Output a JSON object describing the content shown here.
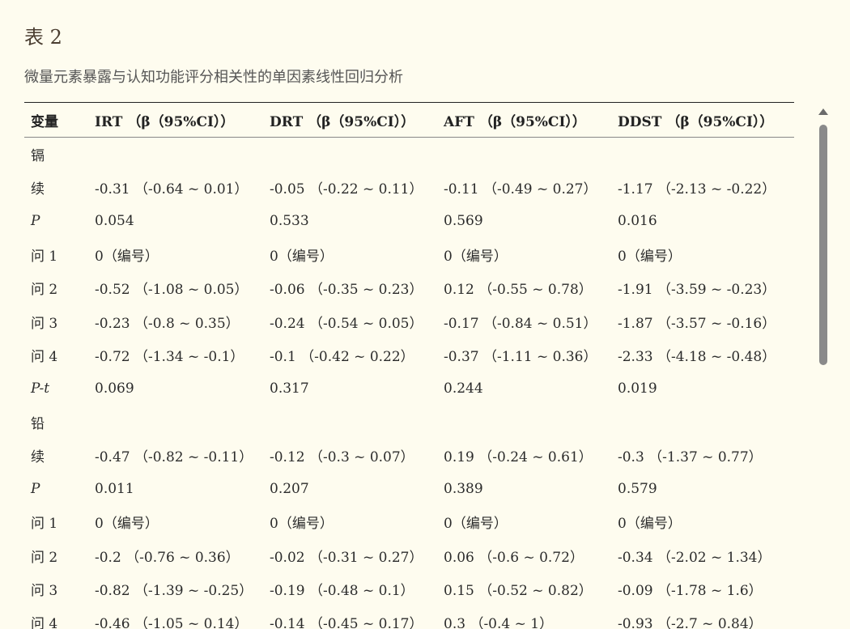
{
  "table_label": "表 2",
  "caption": "微量元素暴露与认知功能评分相关性的单因素线性回归分析",
  "headers": [
    "变量",
    "IRT （β（95%CI））",
    "DRT （β（95%CI））",
    "AFT （β（95%CI））",
    "DDST （β（95%CI））"
  ],
  "rows": [
    [
      "镉",
      "",
      "",
      "",
      ""
    ],
    [
      "续",
      "-0.31 （-0.64 ~ 0.01）",
      "-0.05 （-0.22 ~ 0.11）",
      "-0.11 （-0.49 ~ 0.27）",
      "-1.17 （-2.13 ~ -0.22）"
    ],
    [
      "P",
      "0.054",
      "0.533",
      "0.569",
      "0.016"
    ],
    [
      "问 1",
      "0（编号）",
      "0（编号）",
      "0（编号）",
      "0（编号）"
    ],
    [
      "问 2",
      "-0.52 （-1.08 ~ 0.05）",
      "-0.06 （-0.35 ~ 0.23）",
      "0.12 （-0.55 ~ 0.78）",
      "-1.91 （-3.59 ~ -0.23）"
    ],
    [
      "问 3",
      "-0.23 （-0.8 ~ 0.35）",
      "-0.24 （-0.54 ~ 0.05）",
      "-0.17 （-0.84 ~ 0.51）",
      "-1.87 （-3.57 ~ -0.16）"
    ],
    [
      "问 4",
      "-0.72 （-1.34 ~ -0.1）",
      "-0.1 （-0.42 ~ 0.22）",
      "-0.37 （-1.11 ~ 0.36）",
      "-2.33 （-4.18 ~ -0.48）"
    ],
    [
      "P-t",
      "0.069",
      "0.317",
      "0.244",
      "0.019"
    ],
    [
      "铅",
      "",
      "",
      "",
      ""
    ],
    [
      "续",
      "-0.47 （-0.82 ~ -0.11）",
      "-0.12 （-0.3 ~ 0.07）",
      "0.19 （-0.24 ~ 0.61）",
      "-0.3 （-1.37 ~ 0.77）"
    ],
    [
      "P",
      "0.011",
      "0.207",
      "0.389",
      "0.579"
    ],
    [
      "问 1",
      "0（编号）",
      "0（编号）",
      "0（编号）",
      "0（编号）"
    ],
    [
      "问 2",
      "-0.2 （-0.76 ~ 0.36）",
      "-0.02 （-0.31 ~ 0.27）",
      "0.06 （-0.6 ~ 0.72）",
      "-0.34 （-2.02 ~ 1.34）"
    ],
    [
      "问 3",
      "-0.82 （-1.39 ~ -0.25）",
      "-0.19 （-0.48 ~ 0.1）",
      "0.15 （-0.52 ~ 0.82）",
      "-0.09 （-1.78 ~ 1.6）"
    ],
    [
      "问 4",
      "-0.46 （-1.05 ~ 0.14）",
      "-0.14 （-0.45 ~ 0.17）",
      "0.3 （-0.4 ~ 1）",
      "-0.93 （-2.7 ~ 0.84）"
    ]
  ],
  "italic_first_cells": [
    "P",
    "P-t"
  ]
}
